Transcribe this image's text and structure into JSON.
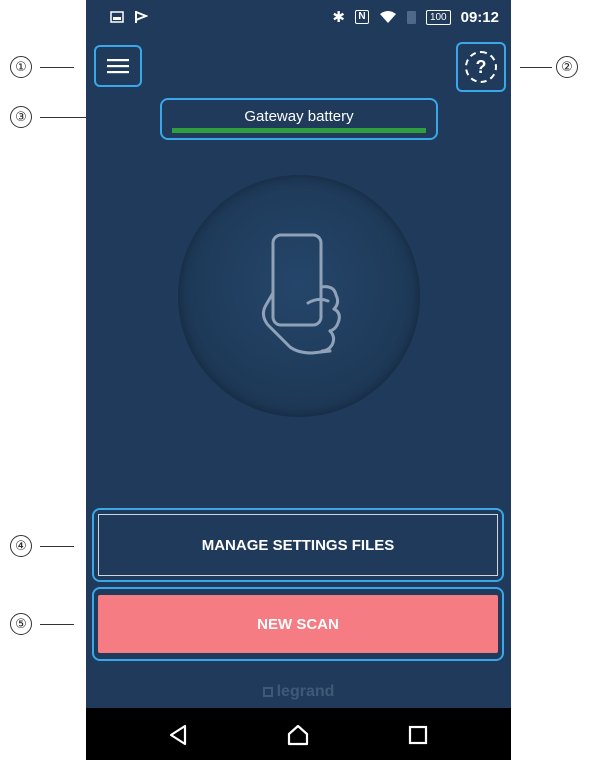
{
  "status_bar": {
    "battery_text": "100",
    "time": "09:12"
  },
  "icons": {
    "menu": "menu-icon",
    "help": "help-icon",
    "hand_phone": "hand-phone-icon",
    "back": "back-icon",
    "home": "home-icon",
    "recents": "recents-icon"
  },
  "gateway_battery": {
    "label": "Gateway battery",
    "level_fraction": 1.0,
    "fill_color": "#2e9e3e"
  },
  "buttons": {
    "manage_label": "MANAGE SETTINGS FILES",
    "new_scan_label": "NEW SCAN",
    "new_scan_color": "#f47c82"
  },
  "brand": {
    "logo_text": "legrand"
  },
  "callouts": [
    "①",
    "②",
    "③",
    "④",
    "⑤"
  ],
  "colors": {
    "background": "#1f3a5a",
    "highlight": "#3aa7e8"
  }
}
